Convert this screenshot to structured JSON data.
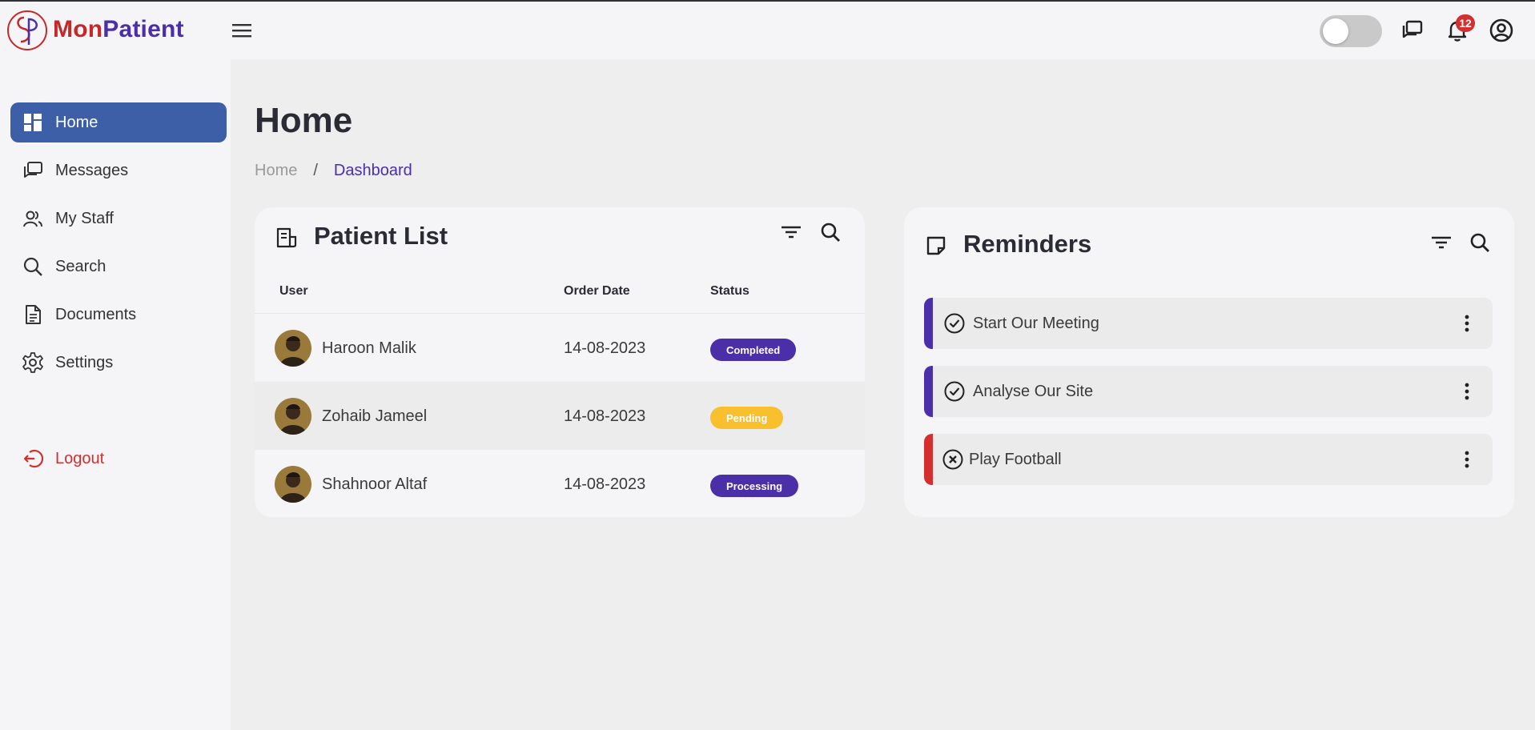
{
  "brand": {
    "part1": "Mon",
    "part2": "Patient"
  },
  "topbar": {
    "notification_count": "12",
    "theme_toggle_on": false
  },
  "sidebar": {
    "items": [
      {
        "label": "Home",
        "icon": "dashboard-icon"
      },
      {
        "label": "Messages",
        "icon": "chat-icon"
      },
      {
        "label": "My Staff",
        "icon": "people-icon"
      },
      {
        "label": "Search",
        "icon": "search-icon"
      },
      {
        "label": "Documents",
        "icon": "document-icon"
      },
      {
        "label": "Settings",
        "icon": "gear-icon"
      }
    ],
    "logout": "Logout"
  },
  "page": {
    "title": "Home",
    "breadcrumb": {
      "home": "Home",
      "separator": "/",
      "current": "Dashboard"
    }
  },
  "patients": {
    "title": "Patient List",
    "columns": {
      "user": "User",
      "order_date": "Order Date",
      "status": "Status"
    },
    "rows": [
      {
        "name": "Haroon Malik",
        "date": "14-08-2023",
        "status": "Completed",
        "status_color": "#4a2fa8"
      },
      {
        "name": "Zohaib Jameel",
        "date": "14-08-2023",
        "status": "Pending",
        "status_color": "#f9c02d"
      },
      {
        "name": "Shahnoor Altaf",
        "date": "14-08-2023",
        "status": "Processing",
        "status_color": "#4a2fa8"
      }
    ]
  },
  "reminders": {
    "title": "Reminders",
    "items": [
      {
        "text": "Start Our Meeting",
        "state": "done",
        "accent": "#4a2fa8"
      },
      {
        "text": "Analyse Our Site",
        "state": "done",
        "accent": "#4a2fa8"
      },
      {
        "text": "Play Football",
        "state": "cancelled",
        "accent": "#d32f2f"
      }
    ]
  },
  "colors": {
    "primary": "#3d5fa8",
    "brand_red": "#c62828",
    "brand_purple": "#4a2fa8",
    "danger": "#d32f2f",
    "warning": "#f9c02d"
  }
}
